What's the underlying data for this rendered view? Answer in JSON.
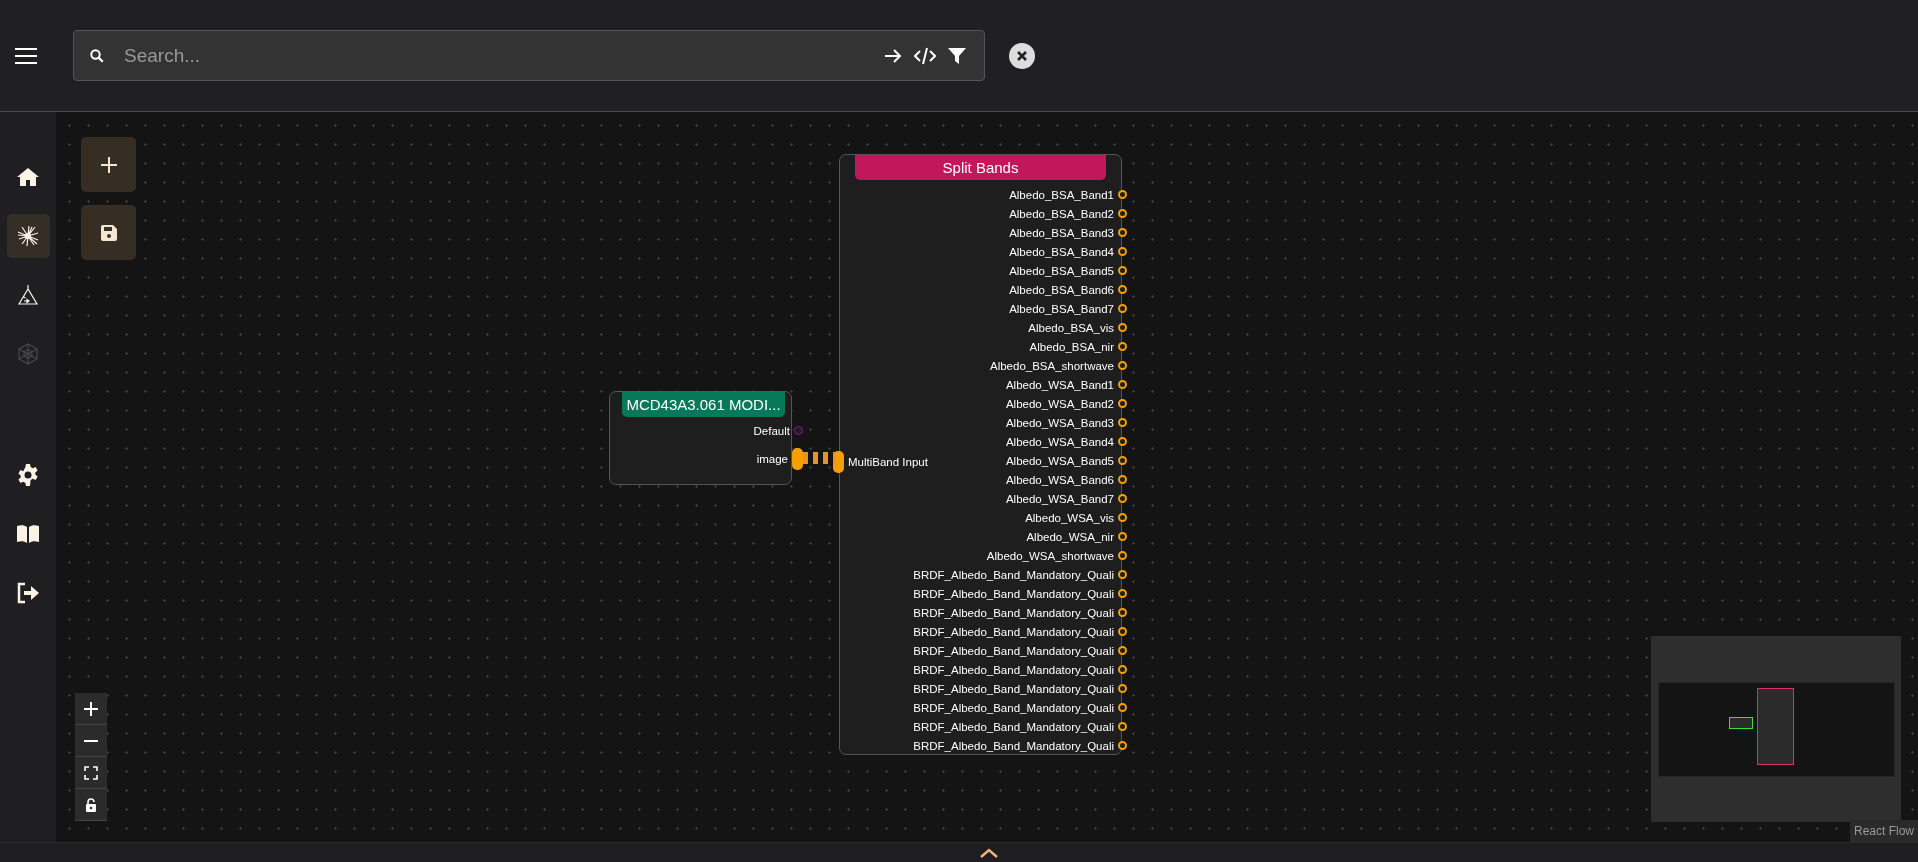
{
  "search": {
    "placeholder": "Search..."
  },
  "sidebar": {
    "items": [
      {
        "kind": "home",
        "selected": false,
        "disabled": false
      },
      {
        "kind": "burst",
        "selected": true,
        "disabled": false
      },
      {
        "kind": "triangle",
        "selected": false,
        "disabled": false
      },
      {
        "kind": "hexagon",
        "selected": false,
        "disabled": true
      }
    ],
    "bottom_items": [
      {
        "kind": "settings",
        "selected": false,
        "disabled": false
      },
      {
        "kind": "book",
        "selected": false,
        "disabled": false
      },
      {
        "kind": "logout",
        "selected": false,
        "disabled": false
      }
    ]
  },
  "nodes": [
    {
      "title": "MCD43A3.061 MODI...",
      "color": "#07795a",
      "outputs": [
        {
          "label": "Default",
          "kind": "default"
        },
        {
          "label": "image",
          "kind": "connected"
        }
      ]
    },
    {
      "title": "Split Bands",
      "color": "#c2185b",
      "inputs": [
        {
          "label": "MultiBand Input",
          "kind": "connected"
        }
      ],
      "outputs": [
        {
          "label": "Albedo_BSA_Band1",
          "kind": "open"
        },
        {
          "label": "Albedo_BSA_Band2",
          "kind": "open"
        },
        {
          "label": "Albedo_BSA_Band3",
          "kind": "open"
        },
        {
          "label": "Albedo_BSA_Band4",
          "kind": "open"
        },
        {
          "label": "Albedo_BSA_Band5",
          "kind": "open"
        },
        {
          "label": "Albedo_BSA_Band6",
          "kind": "open"
        },
        {
          "label": "Albedo_BSA_Band7",
          "kind": "open"
        },
        {
          "label": "Albedo_BSA_vis",
          "kind": "open"
        },
        {
          "label": "Albedo_BSA_nir",
          "kind": "open"
        },
        {
          "label": "Albedo_BSA_shortwave",
          "kind": "open"
        },
        {
          "label": "Albedo_WSA_Band1",
          "kind": "open"
        },
        {
          "label": "Albedo_WSA_Band2",
          "kind": "open"
        },
        {
          "label": "Albedo_WSA_Band3",
          "kind": "open"
        },
        {
          "label": "Albedo_WSA_Band4",
          "kind": "open"
        },
        {
          "label": "Albedo_WSA_Band5",
          "kind": "open"
        },
        {
          "label": "Albedo_WSA_Band6",
          "kind": "open"
        },
        {
          "label": "Albedo_WSA_Band7",
          "kind": "open"
        },
        {
          "label": "Albedo_WSA_vis",
          "kind": "open"
        },
        {
          "label": "Albedo_WSA_nir",
          "kind": "open"
        },
        {
          "label": "Albedo_WSA_shortwave",
          "kind": "open"
        },
        {
          "label": "BRDF_Albedo_Band_Mandatory_Quali",
          "kind": "open"
        },
        {
          "label": "BRDF_Albedo_Band_Mandatory_Quali",
          "kind": "open"
        },
        {
          "label": "BRDF_Albedo_Band_Mandatory_Quali",
          "kind": "open"
        },
        {
          "label": "BRDF_Albedo_Band_Mandatory_Quali",
          "kind": "open"
        },
        {
          "label": "BRDF_Albedo_Band_Mandatory_Quali",
          "kind": "open"
        },
        {
          "label": "BRDF_Albedo_Band_Mandatory_Quali",
          "kind": "open"
        },
        {
          "label": "BRDF_Albedo_Band_Mandatory_Quali",
          "kind": "open"
        },
        {
          "label": "BRDF_Albedo_Band_Mandatory_Quali",
          "kind": "open"
        },
        {
          "label": "BRDF_Albedo_Band_Mandatory_Quali",
          "kind": "open"
        },
        {
          "label": "BRDF_Albedo_Band_Mandatory_Quali",
          "kind": "open"
        }
      ]
    }
  ],
  "attribution": "React Flow"
}
